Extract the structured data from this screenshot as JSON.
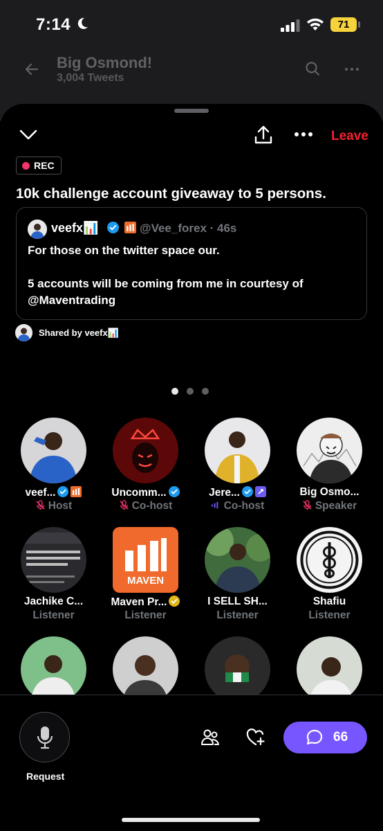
{
  "status_bar": {
    "time": "7:14",
    "battery": "71"
  },
  "profile_header": {
    "name": "Big Osmond!",
    "tweet_count": "3,004 Tweets"
  },
  "space": {
    "leave_label": "Leave",
    "rec_label": "REC",
    "title": "10k challenge account giveaway to 5 persons.",
    "quoted_tweet": {
      "author": "veefx📊",
      "handle": "@Vee_forex · 46s",
      "lines": [
        "For those on the twitter space our.",
        "",
        "5 accounts will be coming from me in courtesy of",
        "@Maventrading"
      ]
    },
    "shared_by": "Shared by veefx📊"
  },
  "participants": [
    {
      "name": "veef...",
      "role": "Host",
      "verified": true,
      "badge": "chart",
      "mic": "muted",
      "avatar_color": "#2a63c7"
    },
    {
      "name": "Uncomm...",
      "role": "Co-host",
      "verified": true,
      "badge": "",
      "mic": "muted",
      "avatar_color": "#8a1414"
    },
    {
      "name": "Jere...",
      "role": "Co-host",
      "verified": true,
      "badge": "purple",
      "mic": "speaking",
      "avatar_color": "#d8a82a"
    },
    {
      "name": "Big Osmo...",
      "role": "Speaker",
      "verified": false,
      "badge": "",
      "mic": "muted",
      "avatar_color": "#c9c9c9"
    },
    {
      "name": "Jachike C...",
      "role": "Listener",
      "verified": false,
      "badge": "",
      "mic": "",
      "avatar_color": "#2c2c30"
    },
    {
      "name": "Maven Pr...",
      "role": "Listener",
      "verified": true,
      "badge": "gold",
      "mic": "",
      "avatar_color": "#ef6a2c"
    },
    {
      "name": "I SELL SH...",
      "role": "Listener",
      "verified": false,
      "badge": "",
      "mic": "",
      "avatar_color": "#4b7c4a"
    },
    {
      "name": "Shafiu",
      "role": "Listener",
      "verified": false,
      "badge": "",
      "mic": "",
      "avatar_color": "#f2f2f2"
    }
  ],
  "bottom_bar": {
    "request_label": "Request",
    "comment_count": "66"
  },
  "colors": {
    "accent": "#7856ff",
    "leave": "#f4212e",
    "rec_dot": "#f2356b",
    "verified": "#1d9bf0"
  }
}
